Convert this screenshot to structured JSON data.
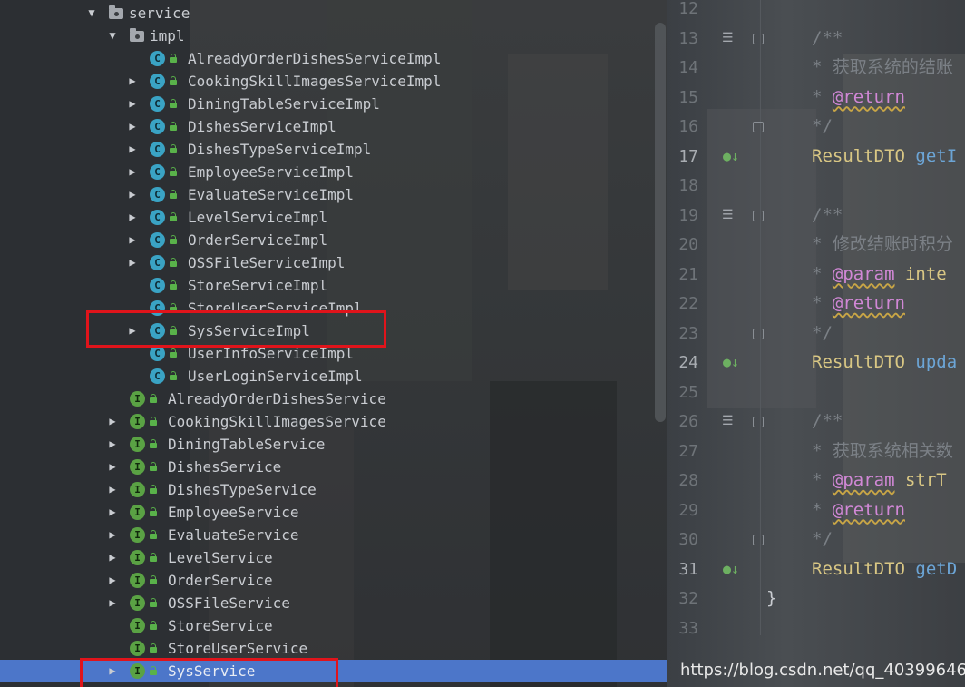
{
  "tree": {
    "rows": [
      {
        "label": "service",
        "kind": "folder",
        "arrow": "▼"
      },
      {
        "label": "impl",
        "kind": "folder",
        "arrow": "▼"
      },
      {
        "label": "AlreadyOrderDishesServiceImpl",
        "kind": "class",
        "arrow": ""
      },
      {
        "label": "CookingSkillImagesServiceImpl",
        "kind": "class",
        "arrow": "▶"
      },
      {
        "label": "DiningTableServiceImpl",
        "kind": "class",
        "arrow": "▶"
      },
      {
        "label": "DishesServiceImpl",
        "kind": "class",
        "arrow": "▶"
      },
      {
        "label": "DishesTypeServiceImpl",
        "kind": "class",
        "arrow": "▶"
      },
      {
        "label": "EmployeeServiceImpl",
        "kind": "class",
        "arrow": "▶"
      },
      {
        "label": "EvaluateServiceImpl",
        "kind": "class",
        "arrow": "▶"
      },
      {
        "label": "LevelServiceImpl",
        "kind": "class",
        "arrow": "▶"
      },
      {
        "label": "OrderServiceImpl",
        "kind": "class",
        "arrow": "▶"
      },
      {
        "label": "OSSFileServiceImpl",
        "kind": "class",
        "arrow": "▶"
      },
      {
        "label": "StoreServiceImpl",
        "kind": "class",
        "arrow": ""
      },
      {
        "label": "StoreUserServiceImpl",
        "kind": "class",
        "arrow": ""
      },
      {
        "label": "SysServiceImpl",
        "kind": "class",
        "arrow": "▶"
      },
      {
        "label": "UserInfoServiceImpl",
        "kind": "class",
        "arrow": ""
      },
      {
        "label": "UserLoginServiceImpl",
        "kind": "class",
        "arrow": ""
      },
      {
        "label": "AlreadyOrderDishesService",
        "kind": "interface",
        "arrow": ""
      },
      {
        "label": "CookingSkillImagesService",
        "kind": "interface",
        "arrow": "▶"
      },
      {
        "label": "DiningTableService",
        "kind": "interface",
        "arrow": "▶"
      },
      {
        "label": "DishesService",
        "kind": "interface",
        "arrow": "▶"
      },
      {
        "label": "DishesTypeService",
        "kind": "interface",
        "arrow": "▶"
      },
      {
        "label": "EmployeeService",
        "kind": "interface",
        "arrow": "▶"
      },
      {
        "label": "EvaluateService",
        "kind": "interface",
        "arrow": "▶"
      },
      {
        "label": "LevelService",
        "kind": "interface",
        "arrow": "▶"
      },
      {
        "label": "OrderService",
        "kind": "interface",
        "arrow": "▶"
      },
      {
        "label": "OSSFileService",
        "kind": "interface",
        "arrow": "▶"
      },
      {
        "label": "StoreService",
        "kind": "interface",
        "arrow": ""
      },
      {
        "label": "StoreUserService",
        "kind": "interface",
        "arrow": ""
      },
      {
        "label": "SysService",
        "kind": "interface",
        "arrow": "▶",
        "selected": true
      }
    ],
    "class_badge": "C",
    "interface_badge": "I"
  },
  "editor": {
    "line_numbers": [
      "12",
      "13",
      "14",
      "15",
      "16",
      "17",
      "18",
      "19",
      "20",
      "21",
      "22",
      "23",
      "24",
      "25",
      "26",
      "27",
      "28",
      "29",
      "30",
      "31",
      "32",
      "33"
    ],
    "lines": [
      {
        "n": "12",
        "parts": []
      },
      {
        "n": "13",
        "parts": [
          {
            "t": "cmt",
            "v": "/**"
          }
        ]
      },
      {
        "n": "14",
        "parts": [
          {
            "t": "cmt",
            "v": " * 获取系统的结账"
          }
        ]
      },
      {
        "n": "15",
        "parts": [
          {
            "t": "cmt",
            "v": " * "
          },
          {
            "t": "tag",
            "v": "@return"
          }
        ]
      },
      {
        "n": "16",
        "parts": [
          {
            "t": "cmt",
            "v": " */"
          }
        ]
      },
      {
        "n": "17",
        "parts": [
          {
            "t": "type",
            "v": "ResultDTO "
          },
          {
            "t": "fn",
            "v": "getI"
          }
        ]
      },
      {
        "n": "18",
        "parts": []
      },
      {
        "n": "19",
        "parts": [
          {
            "t": "cmt",
            "v": "/**"
          }
        ]
      },
      {
        "n": "20",
        "parts": [
          {
            "t": "cmt",
            "v": " * 修改结账时积分"
          }
        ]
      },
      {
        "n": "21",
        "parts": [
          {
            "t": "cmt",
            "v": " * "
          },
          {
            "t": "tag",
            "v": "@param"
          },
          {
            "t": "type",
            "v": " inte"
          }
        ]
      },
      {
        "n": "22",
        "parts": [
          {
            "t": "cmt",
            "v": " * "
          },
          {
            "t": "tag",
            "v": "@return"
          }
        ]
      },
      {
        "n": "23",
        "parts": [
          {
            "t": "cmt",
            "v": " */"
          }
        ]
      },
      {
        "n": "24",
        "parts": [
          {
            "t": "type",
            "v": "ResultDTO "
          },
          {
            "t": "fn",
            "v": "upda"
          }
        ]
      },
      {
        "n": "25",
        "parts": []
      },
      {
        "n": "26",
        "parts": [
          {
            "t": "cmt",
            "v": "/**"
          }
        ]
      },
      {
        "n": "27",
        "parts": [
          {
            "t": "cmt",
            "v": " * 获取系统相关数"
          }
        ]
      },
      {
        "n": "28",
        "parts": [
          {
            "t": "cmt",
            "v": " * "
          },
          {
            "t": "tag",
            "v": "@param"
          },
          {
            "t": "type",
            "v": " strT"
          }
        ]
      },
      {
        "n": "29",
        "parts": [
          {
            "t": "cmt",
            "v": " * "
          },
          {
            "t": "tag",
            "v": "@return"
          }
        ]
      },
      {
        "n": "30",
        "parts": [
          {
            "t": "cmt",
            "v": " */"
          }
        ]
      },
      {
        "n": "31",
        "parts": [
          {
            "t": "type",
            "v": "ResultDTO "
          },
          {
            "t": "fn",
            "v": "getD"
          }
        ]
      },
      {
        "n": "32",
        "parts": [
          {
            "t": "plain",
            "v": "}"
          }
        ]
      },
      {
        "n": "33",
        "parts": []
      }
    ]
  },
  "watermark": "https://blog.csdn.net/qq_40399646",
  "colors": {
    "selection": "#4c76c9",
    "highlight_box": "#e0141b",
    "class_icon": "#3aa3c4",
    "interface_icon": "#5aa244"
  }
}
